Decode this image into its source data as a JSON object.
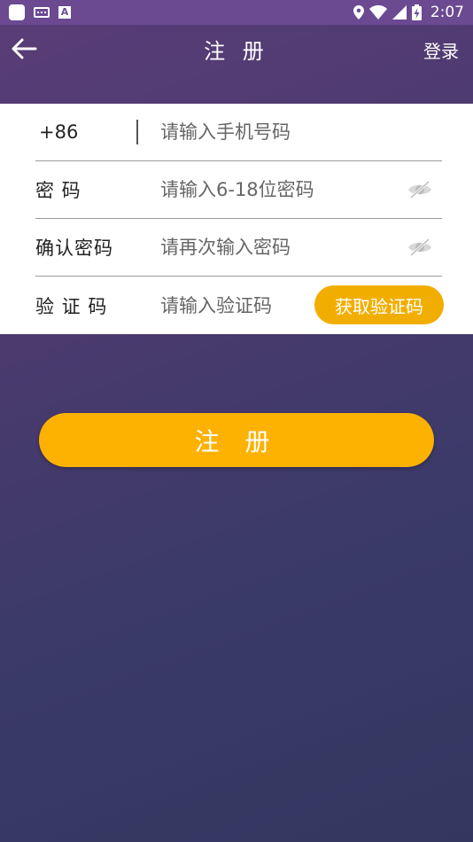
{
  "status_bar": {
    "time": "2:07",
    "icons": [
      "app-icon",
      "keyboard-icon",
      "text-a-icon",
      "location-icon",
      "wifi-icon",
      "signal-icon",
      "battery-charging-icon"
    ],
    "background": "#6b4a92"
  },
  "header": {
    "title": "注 册",
    "login_label": "登录",
    "back_icon": "arrow-left-icon"
  },
  "form": {
    "phone": {
      "country_code": "+86",
      "placeholder": "请输入手机号码"
    },
    "password": {
      "label": "密 码",
      "placeholder": "请输入6-18位密码",
      "toggle_icon": "eye-slash-icon"
    },
    "confirm_password": {
      "label": "确认密码",
      "placeholder": "请再次输入密码",
      "toggle_icon": "eye-slash-icon"
    },
    "verification": {
      "label": "验 证 码",
      "placeholder": "请输入验证码",
      "button_label": "获取验证码"
    }
  },
  "submit": {
    "label": "注 册"
  },
  "colors": {
    "accent": "#fdb100",
    "code_button": "#f2ae00",
    "background_top": "#5a3d78",
    "background_bottom": "#33375f"
  }
}
